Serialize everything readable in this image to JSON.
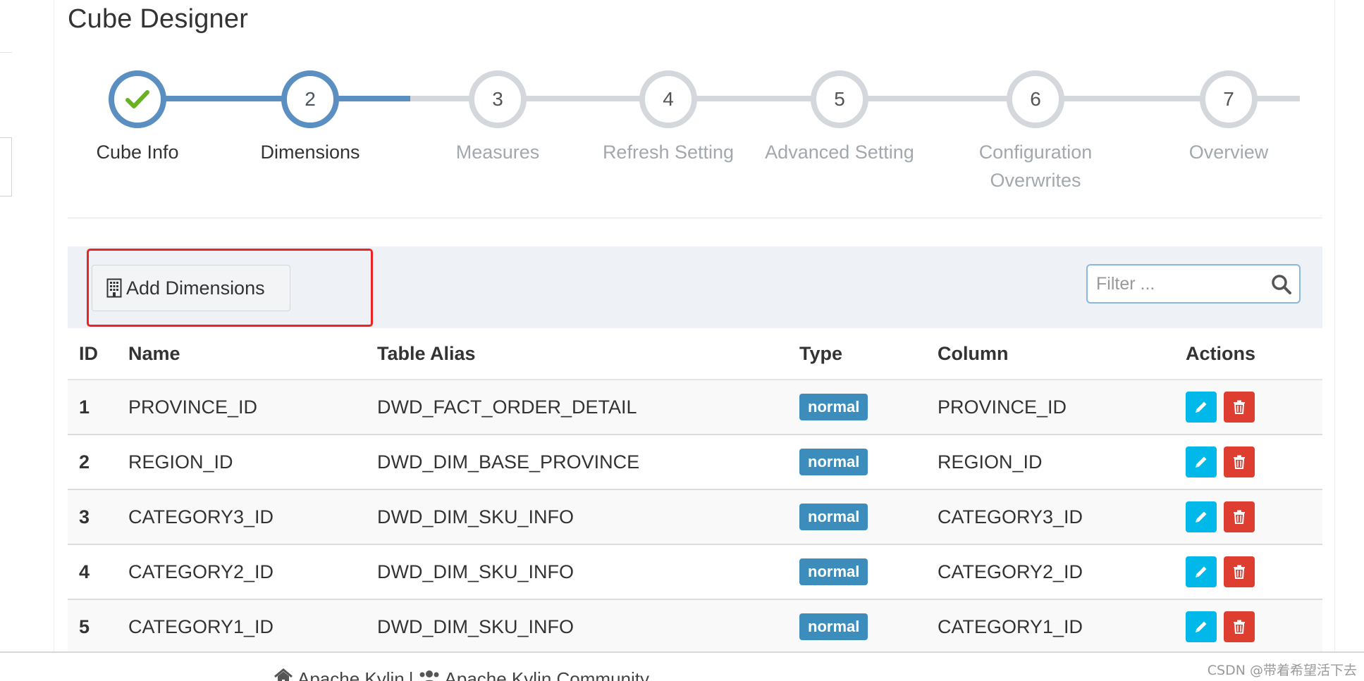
{
  "page": {
    "title": "Cube Designer"
  },
  "wizard": {
    "steps": [
      {
        "number": "",
        "label": "Cube Info",
        "state": "complete"
      },
      {
        "number": "2",
        "label": "Dimensions",
        "state": "active"
      },
      {
        "number": "3",
        "label": "Measures",
        "state": "todo"
      },
      {
        "number": "4",
        "label": "Refresh Setting",
        "state": "todo"
      },
      {
        "number": "5",
        "label": "Advanced Setting",
        "state": "todo"
      },
      {
        "number": "6",
        "label_line1": "Configuration",
        "label_line2": "Overwrites",
        "state": "todo"
      },
      {
        "number": "7",
        "label": "Overview",
        "state": "todo"
      }
    ]
  },
  "toolbar": {
    "add_label": "Add Dimensions",
    "filter_placeholder": "Filter ..."
  },
  "table": {
    "headers": {
      "id": "ID",
      "name": "Name",
      "alias": "Table Alias",
      "type": "Type",
      "column": "Column",
      "actions": "Actions"
    },
    "rows": [
      {
        "id": "1",
        "name": "PROVINCE_ID",
        "alias": "DWD_FACT_ORDER_DETAIL",
        "type": "normal",
        "column": "PROVINCE_ID"
      },
      {
        "id": "2",
        "name": "REGION_ID",
        "alias": "DWD_DIM_BASE_PROVINCE",
        "type": "normal",
        "column": "REGION_ID"
      },
      {
        "id": "3",
        "name": "CATEGORY3_ID",
        "alias": "DWD_DIM_SKU_INFO",
        "type": "normal",
        "column": "CATEGORY3_ID"
      },
      {
        "id": "4",
        "name": "CATEGORY2_ID",
        "alias": "DWD_DIM_SKU_INFO",
        "type": "normal",
        "column": "CATEGORY2_ID"
      },
      {
        "id": "5",
        "name": "CATEGORY1_ID",
        "alias": "DWD_DIM_SKU_INFO",
        "type": "normal",
        "column": "CATEGORY1_ID"
      }
    ]
  },
  "footer": {
    "link1": "Apache Kylin",
    "separator": "|",
    "link2": "Apache Kylin Community"
  },
  "watermark": "CSDN @带着希望活下去",
  "colors": {
    "accent": "#5b8fc1",
    "badge": "#3c8dbc",
    "edit": "#00b8ea",
    "delete": "#dd3e30",
    "highlight": "#ee2222",
    "check": "#6ab023"
  }
}
